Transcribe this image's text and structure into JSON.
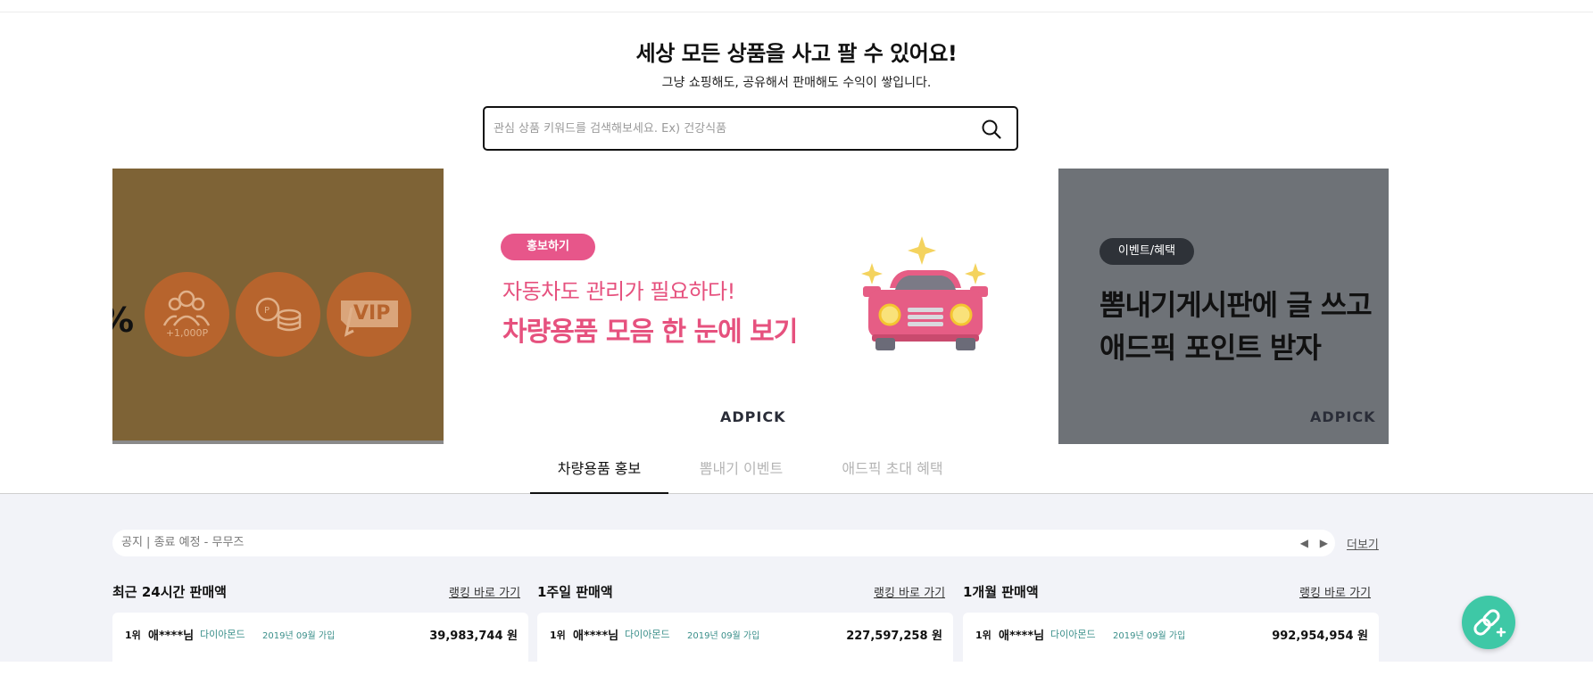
{
  "header": {
    "headline": "세상 모든 상품을 사고 팔 수 있어요!",
    "subline": "그냥 쇼핑해도, 공유해서 판매해도 수익이 쌓입니다."
  },
  "search": {
    "placeholder": "관심 상품 키워드를 검색해보세요. Ex) 건강식품",
    "icon": "search-icon"
  },
  "banners": {
    "left": {
      "fragment": "%",
      "points_caption": "+1,000P",
      "vip_label": "VIP",
      "icons": [
        "users-icon",
        "coins-icon",
        "vip-ticket-icon"
      ]
    },
    "center": {
      "badge": "홍보하기",
      "line1": "자동차도 관리가 필요하다!",
      "line2": "차량용품 모음 한 눈에 보기",
      "brand": "ADPICK",
      "icon": "car-icon"
    },
    "right": {
      "badge": "이벤트/혜택",
      "line1": "뽐내기게시판에 글 쓰고",
      "line2": "애드픽 포인트 받자",
      "brand": "ADPICK"
    }
  },
  "tabs": [
    {
      "label": "차량용품 홍보",
      "active": true
    },
    {
      "label": "뽐내기 이벤트",
      "active": false
    },
    {
      "label": "애드픽 초대 혜택",
      "active": false
    }
  ],
  "notice": {
    "text": "공지 | 종료 예정 - 무무즈",
    "more": "더보기"
  },
  "sections": [
    {
      "title": "최근 24시간 판매액",
      "link": "랭킹 바로 가기",
      "row": {
        "rank": "1위",
        "nick": "애****님",
        "grade": "다이아몬드",
        "joined": "2019년 09월 가입",
        "amount": "39,983,744 원"
      }
    },
    {
      "title": "1주일 판매액",
      "link": "랭킹 바로 가기",
      "row": {
        "rank": "1위",
        "nick": "애****님",
        "grade": "다이아몬드",
        "joined": "2019년 09월 가입",
        "amount": "227,597,258 원"
      }
    },
    {
      "title": "1개월 판매액",
      "link": "랭킹 바로 가기",
      "row": {
        "rank": "1위",
        "nick": "애****님",
        "grade": "다이아몬드",
        "joined": "2019년 09월 가입",
        "amount": "992,954,954 원"
      }
    }
  ],
  "fab": {
    "icon": "link-add-icon"
  },
  "colors": {
    "accent_pink": "#e6517e",
    "badge_pink": "#e7568a",
    "teal": "#3ec8a6",
    "banner_left_bg": "#7e6336",
    "banner_right_bg": "#6e7277",
    "lower_bg": "#f2f3f8"
  }
}
